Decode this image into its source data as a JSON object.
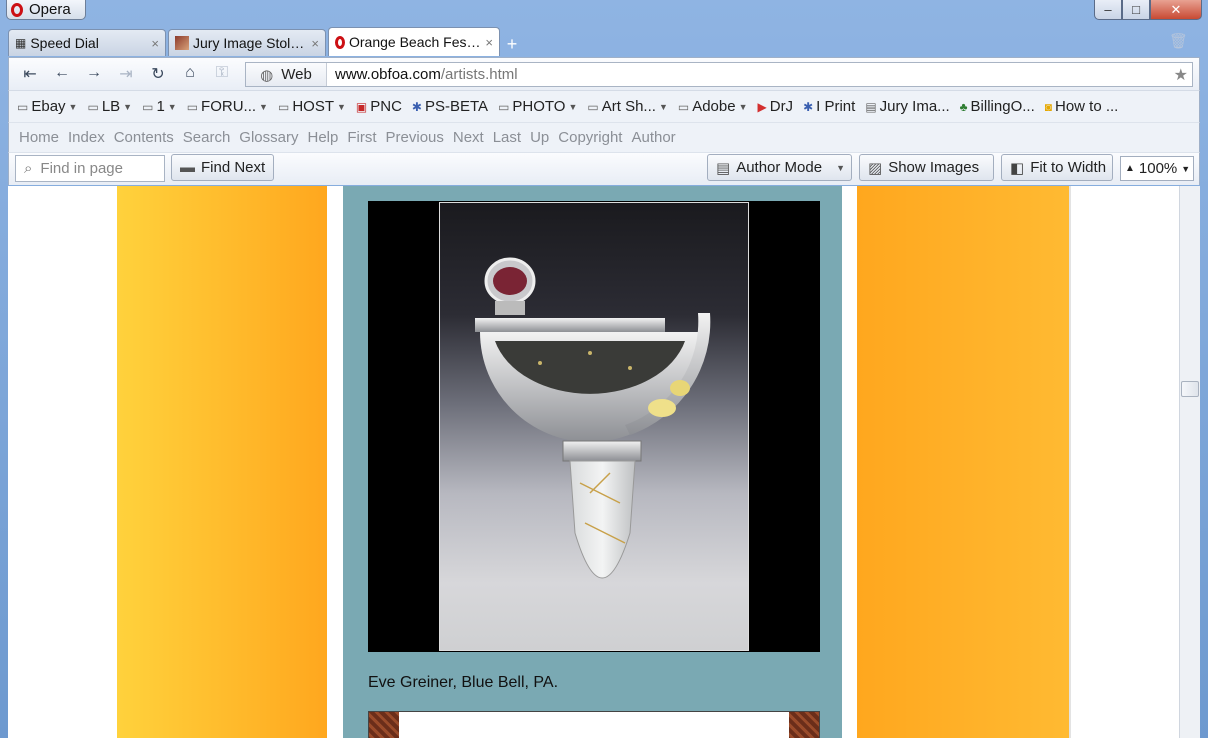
{
  "window": {
    "app_label": "Opera",
    "minimize": "–",
    "maximize": "□",
    "close": "✕"
  },
  "tabs": [
    {
      "label": "Speed Dial",
      "icon": "grid-icon",
      "close": "×"
    },
    {
      "label": "Jury Image Stolen ...",
      "icon": "page-thumbnail-icon",
      "close": "×"
    },
    {
      "label": "Orange Beach Fest...",
      "icon": "opera-icon",
      "close": "×"
    }
  ],
  "new_tab": "+",
  "address_bar": {
    "web_button": "Web",
    "url_domain": "www.obfoa.com",
    "url_path": "/artists.html"
  },
  "bookmarks": [
    {
      "label": "Ebay",
      "icon": "folder-icon",
      "has_menu": true
    },
    {
      "label": "LB",
      "icon": "folder-icon",
      "has_menu": true
    },
    {
      "label": "1",
      "icon": "folder-icon",
      "has_menu": true
    },
    {
      "label": "FORU...",
      "icon": "folder-icon",
      "has_menu": true
    },
    {
      "label": "HOST",
      "icon": "folder-icon",
      "has_menu": true
    },
    {
      "label": "PNC",
      "icon": "pnc-icon",
      "has_menu": false
    },
    {
      "label": "PS-BETA",
      "icon": "star-square-icon",
      "has_menu": false
    },
    {
      "label": "PHOTO",
      "icon": "folder-icon",
      "has_menu": true
    },
    {
      "label": "Art Sh...",
      "icon": "folder-icon",
      "has_menu": true
    },
    {
      "label": "Adobe",
      "icon": "folder-icon",
      "has_menu": true
    },
    {
      "label": "DrJ",
      "icon": "youtube-icon",
      "has_menu": false
    },
    {
      "label": "I Print",
      "icon": "star-square-icon",
      "has_menu": false
    },
    {
      "label": "Jury Ima...",
      "icon": "page-icon",
      "has_menu": false
    },
    {
      "label": "BillingO...",
      "icon": "tree-icon",
      "has_menu": false
    },
    {
      "label": "How to ...",
      "icon": "cup-icon",
      "has_menu": false
    }
  ],
  "navigation_links": [
    "Home",
    "Index",
    "Contents",
    "Search",
    "Glossary",
    "Help",
    "First",
    "Previous",
    "Next",
    "Last",
    "Up",
    "Copyright",
    "Author"
  ],
  "find_bar": {
    "placeholder": "Find in page",
    "find_next": "Find Next",
    "author_mode": "Author Mode",
    "show_images": "Show Images",
    "fit_to_width": "Fit to Width",
    "zoom": "100%"
  },
  "page": {
    "caption": "Eve Greiner, Blue Bell, PA."
  },
  "colors": {
    "accent_orange": "#ffa71e",
    "panel_teal": "#7aa9b3",
    "opera_red": "#cc1014"
  }
}
